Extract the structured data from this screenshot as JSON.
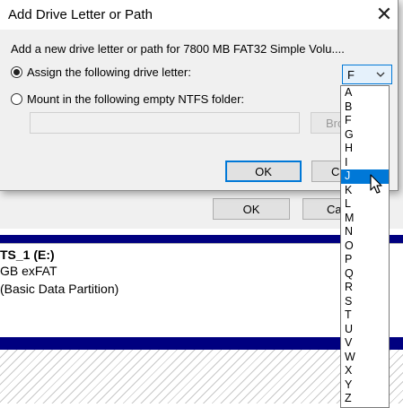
{
  "background": {
    "ok_label": "OK",
    "cancel_partial": "Can",
    "volume_name": "TS_1  (E:)",
    "volume_size": "GB exFAT",
    "volume_type": "(Basic Data Partition)"
  },
  "dialog": {
    "title": "Add Drive Letter or Path",
    "description": "Add a new drive letter or path for 7800 MB FAT32 Simple Volu....",
    "assign_label": "Assign the following drive letter:",
    "mount_label": "Mount in the following empty NTFS folder:",
    "folder_path": "",
    "browse_label": "Bro",
    "ok_label": "OK",
    "cancel_label": "Ca",
    "selected_letter": "F",
    "assign_checked": true,
    "mount_checked": false
  },
  "dropdown": {
    "options": [
      "A",
      "B",
      "F",
      "G",
      "H",
      "I",
      "J",
      "K",
      "L",
      "M",
      "N",
      "O",
      "P",
      "Q",
      "R",
      "S",
      "T",
      "U",
      "V",
      "W",
      "X",
      "Y",
      "Z"
    ],
    "highlighted": "J"
  },
  "icons": {
    "close": "close-icon",
    "dropdown_arrow": "chevron-down-icon",
    "cursor": "mouse-pointer-icon"
  },
  "colors": {
    "accent": "#0078d7",
    "disk_band": "#000080"
  }
}
